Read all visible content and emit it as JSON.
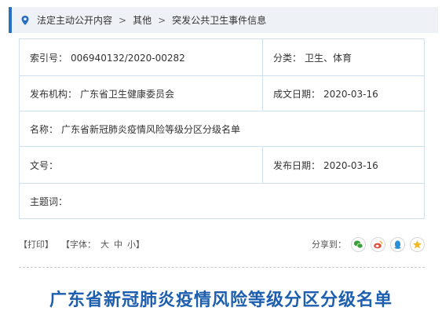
{
  "breadcrumb": {
    "items": [
      "法定主动公开内容",
      "其他",
      "突发公共卫生事件信息"
    ],
    "separator": ">"
  },
  "info": {
    "index_label": "索引号：",
    "index_value": "006940132/2020-00282",
    "category_label": "分类：",
    "category_value": "卫生、体育",
    "issuer_label": "发布机构：",
    "issuer_value": "广东省卫生健康委员会",
    "written_date_label": "成文日期：",
    "written_date_value": "2020-03-16",
    "name_label": "名称：",
    "name_value": "广东省新冠肺炎疫情风险等级分区分级名单",
    "doc_no_label": "文号：",
    "doc_no_value": "",
    "publish_date_label": "发布日期：",
    "publish_date_value": "2020-03-16",
    "subject_label": "主题词：",
    "subject_value": ""
  },
  "tools": {
    "print_label": "【打印】",
    "font_label": "【字体：",
    "font_large": "大",
    "font_medium": "中",
    "font_small": "小】",
    "share_label": "分享到："
  },
  "icons": {
    "location": "map-pin-icon",
    "wechat": "wechat-icon",
    "weibo": "weibo-icon",
    "qq": "qq-icon",
    "qzone": "qzone-star-icon"
  },
  "colors": {
    "accent": "#2a6fc1",
    "title": "#1d5fae",
    "table_border": "#cfdff0",
    "breadcrumb_bg": "#eef1f5"
  },
  "title": "广东省新冠肺炎疫情风险等级分区分级名单"
}
